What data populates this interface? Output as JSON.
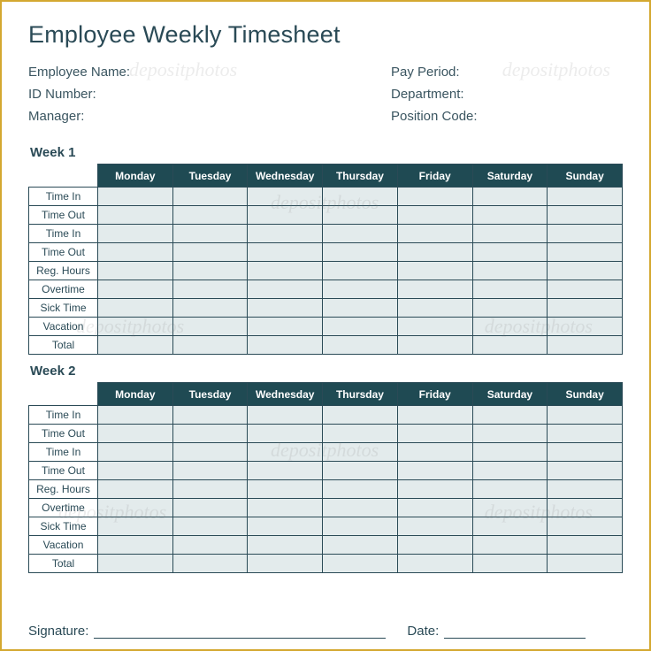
{
  "title": "Employee Weekly Timesheet",
  "meta": {
    "left": [
      "Employee Name:",
      "ID Number:",
      "Manager:"
    ],
    "right": [
      "Pay Period:",
      "Department:",
      "Position Code:"
    ]
  },
  "days": [
    "Monday",
    "Tuesday",
    "Wednesday",
    "Thursday",
    "Friday",
    "Saturday",
    "Sunday"
  ],
  "rows": [
    "Time In",
    "Time Out",
    "Time In",
    "Time Out",
    "Reg. Hours",
    "Overtime",
    "Sick Time",
    "Vacation",
    "Total"
  ],
  "weeks": [
    {
      "label": "Week 1"
    },
    {
      "label": "Week 2"
    }
  ],
  "footer": {
    "signature": "Signature:",
    "date": "Date:"
  },
  "watermark": "depositphotos"
}
